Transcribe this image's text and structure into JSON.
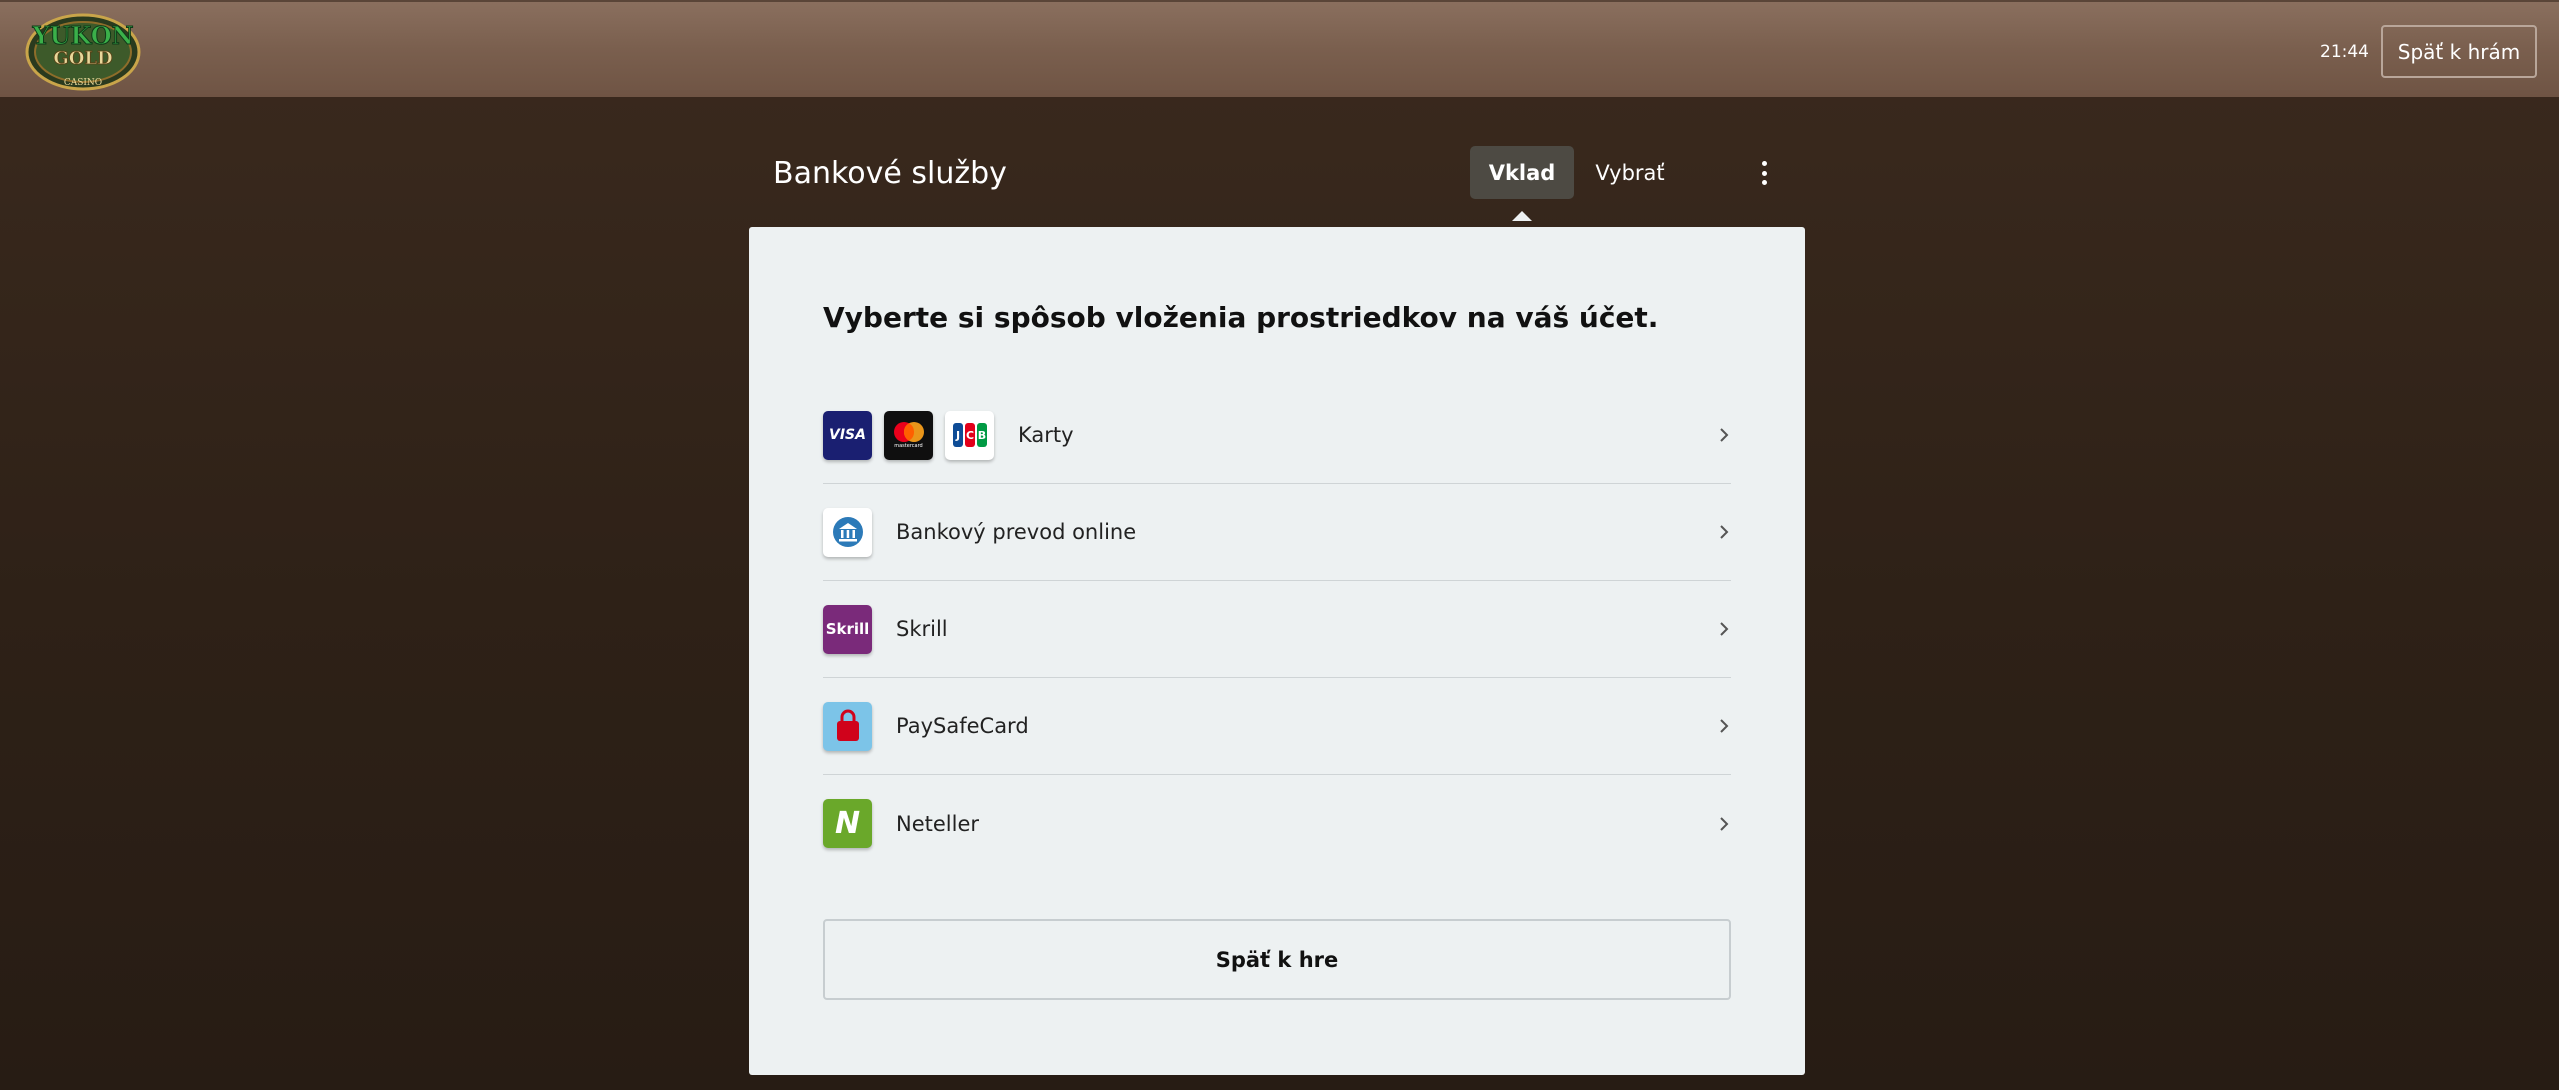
{
  "topbar": {
    "logo_text": [
      "YUKON",
      "GOLD",
      "CASINO"
    ],
    "clock": "21:44",
    "back_to_games_label": "Späť k hrám"
  },
  "header": {
    "title": "Bankové služby",
    "tabs": [
      {
        "label": "Vklad",
        "active": true
      },
      {
        "label": "Vybrať",
        "active": false
      }
    ],
    "more_icon": "kebab-menu-icon"
  },
  "panel": {
    "heading": "Vyberte si spôsob vloženia prostriedkov na váš účet.",
    "methods": [
      {
        "label": "Karty",
        "icons": [
          "visa-icon",
          "mastercard-icon",
          "jcb-icon"
        ]
      },
      {
        "label": "Bankový prevod online",
        "icons": [
          "bank-icon"
        ]
      },
      {
        "label": "Skrill",
        "icons": [
          "skrill-icon"
        ]
      },
      {
        "label": "PaySafeCard",
        "icons": [
          "paysafecard-icon"
        ]
      },
      {
        "label": "Neteller",
        "icons": [
          "neteller-icon"
        ]
      }
    ],
    "icon_text": {
      "visa": "VISA",
      "mastercard": "mastercard",
      "skrill": "Skrill",
      "neteller": "N"
    },
    "back_button_label": "Späť k hre"
  },
  "colors": {
    "topbar": "#7a5f4e",
    "background": "#2e2117",
    "active_tab": "#4d4a43",
    "panel": "#edf1f2",
    "skrill": "#7a2a7a",
    "neteller": "#6aa82a",
    "paysafecard": "#7cc4e8",
    "visa": "#1a1f71"
  }
}
